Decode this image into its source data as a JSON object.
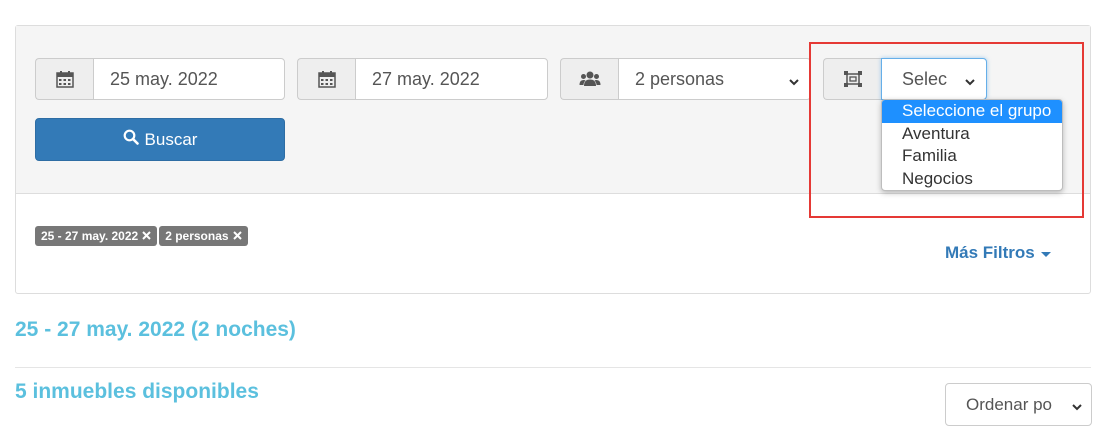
{
  "search": {
    "checkin": {
      "value": "25 may. 2022",
      "icon": "calendar-icon"
    },
    "checkout": {
      "value": "27 may. 2022",
      "icon": "calendar-icon"
    },
    "guests": {
      "value": "2 personas",
      "icon": "users-icon"
    },
    "group": {
      "value": "Selec",
      "icon": "group-select-icon",
      "options": [
        "Seleccione el grupo",
        "Aventura",
        "Familia",
        "Negocios"
      ],
      "highlighted_option": "Seleccione el grupo"
    },
    "search_button": "Buscar"
  },
  "filters": {
    "tags": [
      {
        "label": "25 - 27 may. 2022"
      },
      {
        "label": "2 personas"
      }
    ],
    "more_filters": "Más Filtros"
  },
  "results": {
    "dates_heading": "25 - 27 may. 2022 (2 noches)",
    "count_heading": "5 inmuebles disponibles",
    "sort_select": "Ordenar po"
  },
  "colors": {
    "primary": "#337ab7",
    "heading": "#5bc0de",
    "tag_bg": "#777777",
    "highlight": "#1e90ff",
    "annotation": "#e53935"
  }
}
